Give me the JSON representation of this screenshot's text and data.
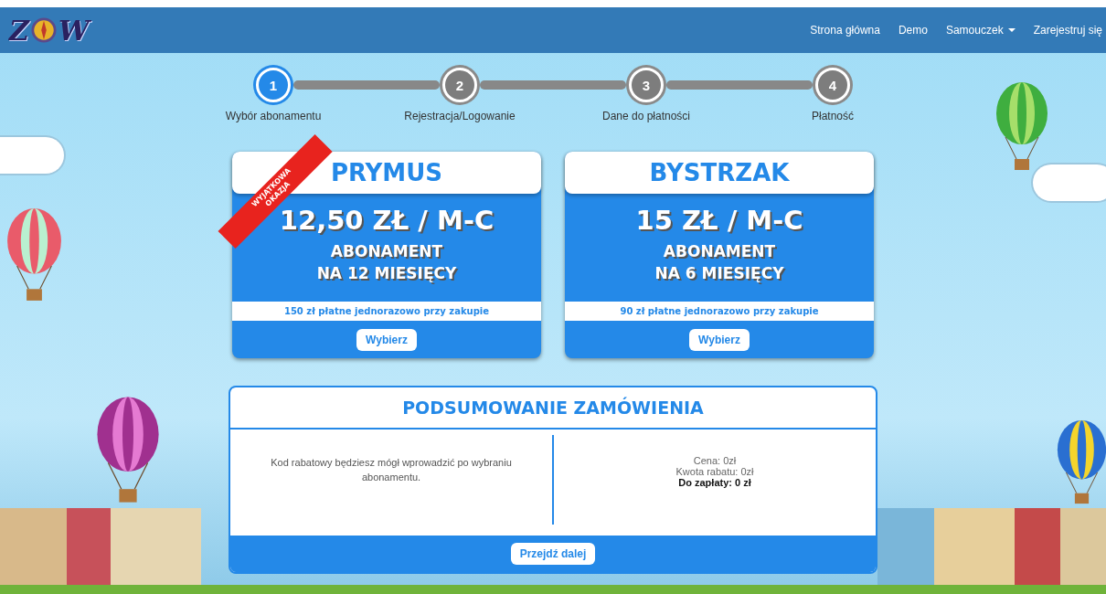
{
  "logo": {
    "left": "Z",
    "right": "W"
  },
  "nav": [
    {
      "label": "Strona główna",
      "dropdown": false
    },
    {
      "label": "Demo",
      "dropdown": false
    },
    {
      "label": "Samouczek",
      "dropdown": true
    },
    {
      "label": "Zarejestruj się",
      "dropdown": false
    }
  ],
  "steps": [
    {
      "number": "1",
      "label": "Wybór abonamentu",
      "selected": true
    },
    {
      "number": "2",
      "label": "Rejestracja/Logowanie",
      "selected": false
    },
    {
      "number": "3",
      "label": "Dane do płatności",
      "selected": false
    },
    {
      "number": "4",
      "label": "Płatność",
      "selected": false
    }
  ],
  "plans": [
    {
      "name": "PRYMUS",
      "price": "12,50 ZŁ / M-C",
      "term": [
        "ABONAMENT",
        "NA 12 MIESIĘCY"
      ],
      "ribbon": [
        "WYJĄTKOWA",
        "OKAZJA"
      ],
      "note": "150 zł płatne jednorazowo przy zakupie",
      "button": "Wybierz"
    },
    {
      "name": "BYSTRZAK",
      "price": "15 ZŁ / M-C",
      "term": [
        "ABONAMENT",
        "NA 6 MIESIĘCY"
      ],
      "note": "90 zł płatne jednorazowo przy zakupie",
      "button": "Wybierz"
    }
  ],
  "summary": {
    "title": "PODSUMOWANIE ZAMÓWIENIA",
    "discount_note": "Kod rabatowy będziesz mógł wprowadzić po wybraniu abonamentu.",
    "lines": [
      {
        "text": "Cena: 0zł",
        "kind": "plain"
      },
      {
        "text": "Kwota rabatu: 0zł",
        "kind": "plain"
      },
      {
        "text": "Do zapłaty: 0 zł",
        "kind": "total"
      }
    ],
    "button": "Przejdź dalej"
  }
}
